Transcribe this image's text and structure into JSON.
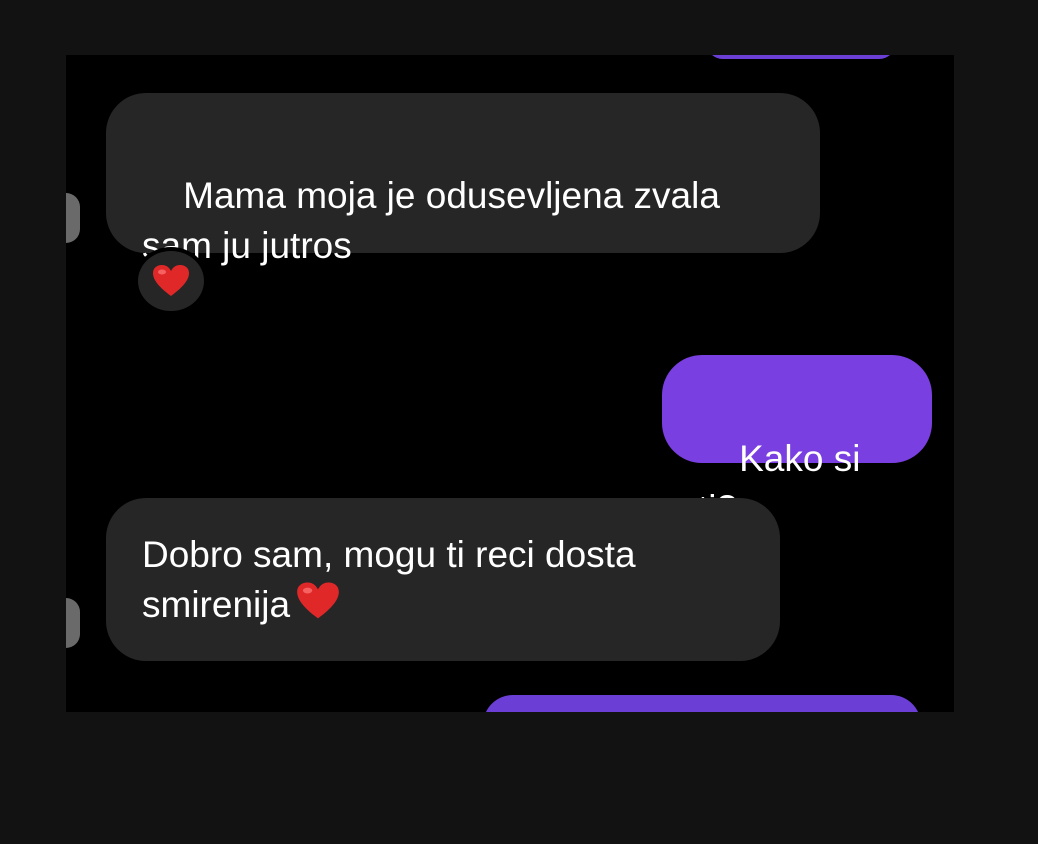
{
  "conversation": {
    "messages": [
      {
        "direction": "incoming",
        "text": "Mama moja je odusevljena zvala\nsam ju jutros",
        "reaction_icon": "heart-icon"
      },
      {
        "direction": "outgoing",
        "text": "Kako si ti?"
      },
      {
        "direction": "incoming",
        "text": "Dobro sam, mogu ti reci dosta\nsmirenija",
        "trailing_icon": "heart-icon"
      }
    ]
  },
  "colors": {
    "incoming_bubble": "#262626",
    "outgoing_bubble": "#7a3fe0",
    "heart": "#e02828",
    "background": "#000000"
  }
}
